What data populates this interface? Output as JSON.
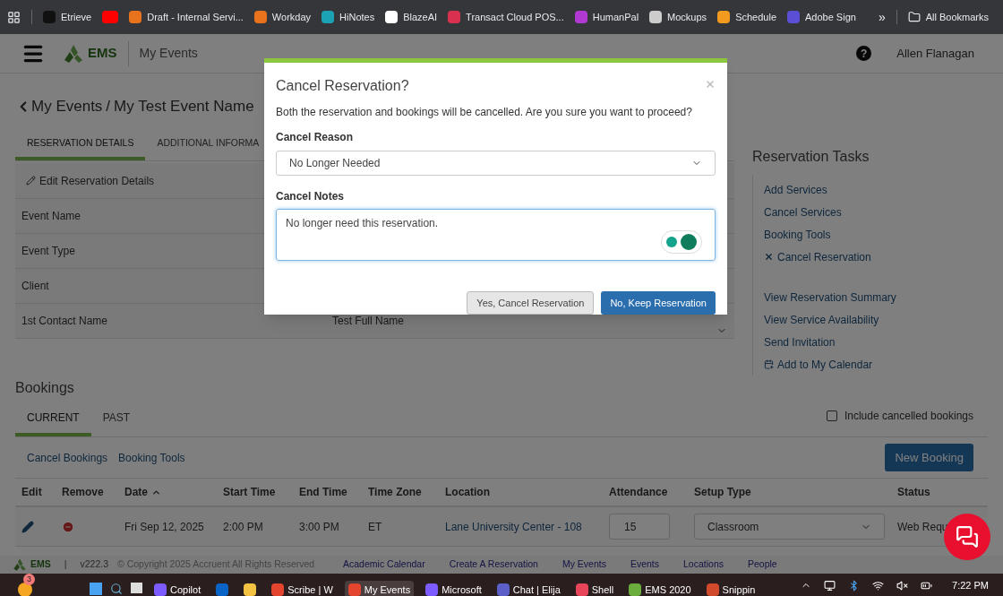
{
  "bookmarks": {
    "items": [
      {
        "kind": "labeled",
        "label": "Etrieve"
      },
      {
        "kind": "icon"
      },
      {
        "kind": "labeled",
        "label": "Draft - Internal Servi..."
      },
      {
        "kind": "labeled",
        "label": "Workday"
      },
      {
        "kind": "labeled",
        "label": "HiNotes"
      },
      {
        "kind": "labeled",
        "label": "BlazeAI"
      },
      {
        "kind": "labeled",
        "label": "Transact Cloud POS..."
      },
      {
        "kind": "labeled",
        "label": "HumanPal"
      },
      {
        "kind": "labeled",
        "label": "Mockups"
      },
      {
        "kind": "labeled",
        "label": "Schedule"
      },
      {
        "kind": "labeled",
        "label": "Adobe Sign"
      }
    ],
    "overflow": "»",
    "all": "All Bookmarks"
  },
  "header": {
    "app_name": "EMS",
    "section": "My Events",
    "help": "?",
    "user": "Allen Flanagan"
  },
  "breadcrumb": {
    "back": "My Events",
    "separator": "/",
    "current": "My Test Event Name"
  },
  "detail_tabs": [
    {
      "label": "RESERVATION DETAILS",
      "selected": true
    },
    {
      "label": "ADDITIONAL INFORMA",
      "selected": false
    }
  ],
  "edit_link": "Edit Reservation Details",
  "details": [
    {
      "label": "Event Name"
    },
    {
      "label": "Event Type"
    },
    {
      "label": "Client"
    },
    {
      "label": "1st Contact Name",
      "value": "Test Full Name"
    }
  ],
  "tasks": {
    "title": "Reservation Tasks",
    "groups": [
      [
        {
          "label": "Add Services",
          "kind": "link"
        },
        {
          "label": "Cancel Services",
          "kind": "link"
        },
        {
          "label": "Booking Tools",
          "kind": "link"
        },
        {
          "label": "Cancel Reservation",
          "kind": "cancel"
        }
      ],
      [
        {
          "label": "View Reservation Summary",
          "kind": "link"
        },
        {
          "label": "View Service Availability",
          "kind": "link"
        },
        {
          "label": "Send Invitation",
          "kind": "link"
        },
        {
          "label": "Add to My Calendar",
          "kind": "calendar"
        }
      ]
    ]
  },
  "bookings": {
    "title": "Bookings",
    "tabs": [
      {
        "label": "CURRENT",
        "selected": true
      },
      {
        "label": "PAST",
        "selected": false
      }
    ],
    "include_cancelled": {
      "label": "Include cancelled bookings",
      "checked": false
    },
    "actions": [
      "Cancel Bookings",
      "Booking Tools"
    ],
    "new_button": "New Booking",
    "table": {
      "columns": [
        {
          "label": "Edit",
          "sorted": false
        },
        {
          "label": "Remove",
          "sorted": false
        },
        {
          "label": "Date",
          "sorted": true
        },
        {
          "label": "Start Time",
          "sorted": false
        },
        {
          "label": "End Time",
          "sorted": false
        },
        {
          "label": "Time Zone",
          "sorted": false
        },
        {
          "label": "Location",
          "sorted": false
        },
        {
          "label": "Attendance",
          "sorted": false
        },
        {
          "label": "Setup Type",
          "sorted": false
        },
        {
          "label": "Status",
          "sorted": false
        }
      ],
      "rows": [
        {
          "date": "Fri Sep 12, 2025",
          "start": "2:00 PM",
          "end": "3:00 PM",
          "time_zone": "ET",
          "location": "Lane University Center - 108",
          "attendance": "15",
          "setup_type": "Classroom",
          "status": "Web Requ"
        }
      ]
    }
  },
  "footer": {
    "app_name": "EMS",
    "separator": "|",
    "version": "v222.3",
    "copyright": "© Copyright 2025 Accruent All Rights Reserved",
    "links": [
      "Academic Calendar",
      "Create A Reservation",
      "My Events",
      "Events",
      "Locations",
      "People"
    ]
  },
  "modal": {
    "title": "Cancel Reservation?",
    "message": "Both the reservation and bookings will be cancelled. Are you sure you want to proceed?",
    "reason_label": "Cancel Reason",
    "reason_value": "No Longer Needed",
    "notes_label": "Cancel Notes",
    "notes_value": "No longer need this reservation. ",
    "confirm": "Yes, Cancel Reservation",
    "keep": "No, Keep Reservation"
  },
  "taskbar": {
    "weather_badge": "3",
    "apps": [
      {
        "label": "Copilot",
        "selected": false
      },
      {
        "selected": false
      },
      {
        "selected": false
      },
      {
        "label": "Scribe | W",
        "selected": false
      },
      {
        "label": "My Events",
        "selected": true
      },
      {
        "label": "Microsoft",
        "selected": false
      },
      {
        "label": "Chat | Elija",
        "selected": false
      },
      {
        "label": "Shell",
        "selected": false
      },
      {
        "label": "EMS 2020",
        "selected": false
      },
      {
        "label": "Snippin",
        "selected": false
      }
    ],
    "time": "7:22 PM"
  }
}
